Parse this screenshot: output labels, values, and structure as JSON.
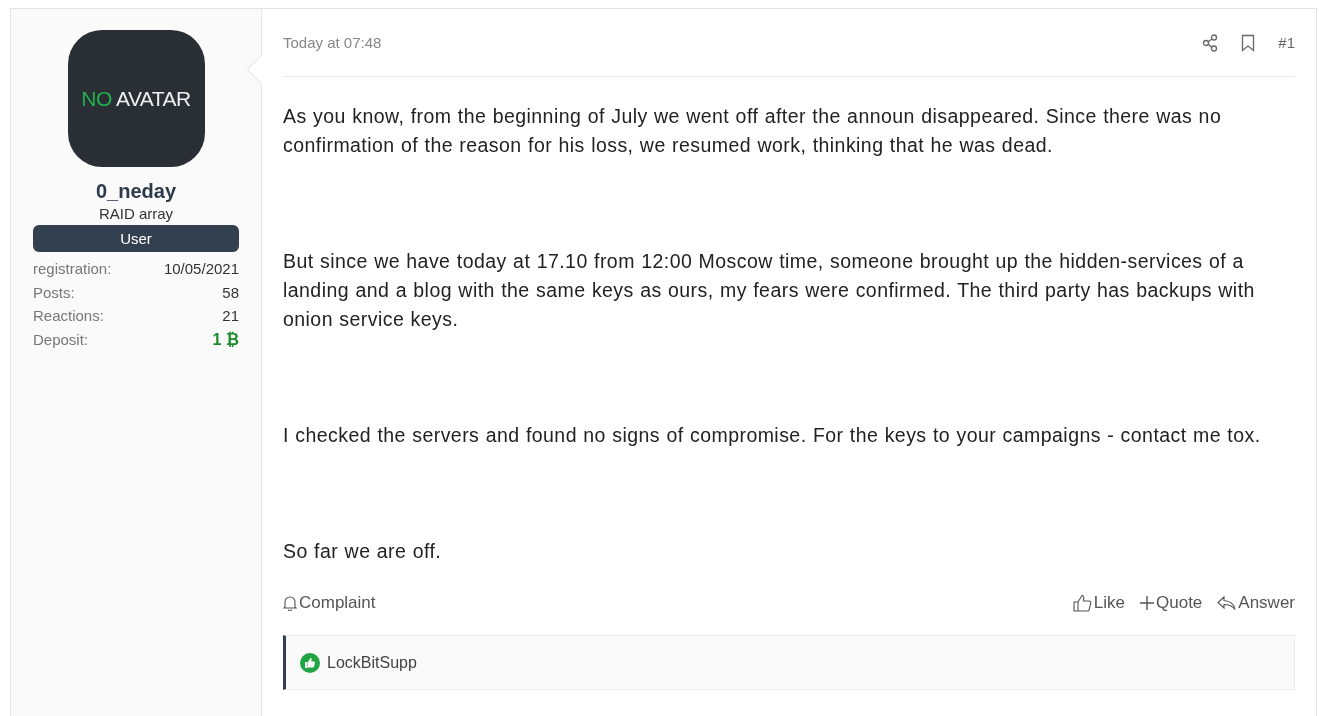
{
  "user": {
    "avatar_text": [
      "NO",
      "AVATAR"
    ],
    "name": "0_neday",
    "title": "RAID array",
    "badge": "User",
    "stats": [
      {
        "label": "registration:",
        "value": "10/05/2021",
        "kind": "plain"
      },
      {
        "label": "Posts:",
        "value": "58",
        "kind": "plain"
      },
      {
        "label": "Reactions:",
        "value": "21",
        "kind": "plain"
      },
      {
        "label": "Deposit:",
        "value": "1 ₿",
        "kind": "deposit"
      }
    ]
  },
  "post": {
    "time": "Today at 07:48",
    "number": "#1",
    "paragraphs": [
      "As you know, from the beginning of July we went off after the announ disappeared. Since there was no confirmation of the reason for his loss, we resumed work, thinking that he was dead.",
      "But since we have today at 17.10 from 12:00 Moscow time, someone brought up the hidden-services of a landing and a blog with the same keys as ours, my fears were confirmed. The third party has backups with onion service keys.",
      "I checked the servers and found no signs of compromise. For the keys to your campaigns - contact me tox.",
      "So far we are off."
    ],
    "complaint": "Complaint",
    "actions": [
      {
        "label": "Like",
        "kind": "like"
      },
      {
        "label": "Quote",
        "kind": "quote"
      },
      {
        "label": "Answer",
        "kind": "answer"
      }
    ],
    "reactions": [
      "LockBitSupp"
    ]
  }
}
